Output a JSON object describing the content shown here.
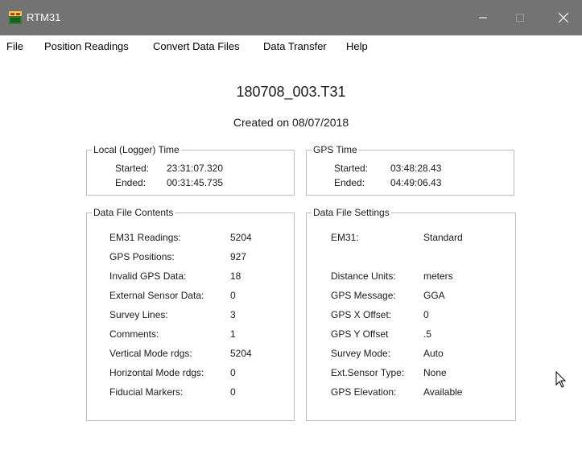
{
  "window": {
    "title": "RTM31",
    "minimize": "—",
    "maximize": "☐",
    "close": "✕",
    "app_icon": "rtm31-app-icon"
  },
  "menu": {
    "file": "File",
    "position": "Position Readings",
    "convert": "Convert Data Files",
    "transfer": "Data Transfer",
    "help": "Help"
  },
  "header": {
    "filename": "180708_003.T31",
    "created": "Created on 08/07/2018"
  },
  "local_time": {
    "title": "Local (Logger) Time",
    "started_label": "Started:",
    "started": "23:31:07.320",
    "ended_label": "Ended:",
    "ended": "00:31:45.735"
  },
  "gps_time": {
    "title": "GPS Time",
    "started_label": "Started:",
    "started": "03:48:28.43",
    "ended_label": "Ended:",
    "ended": "04:49:06.43"
  },
  "contents": {
    "title": "Data File Contents",
    "rows": [
      {
        "label": "EM31 Readings:",
        "value": "5204"
      },
      {
        "label": "GPS Positions:",
        "value": "927"
      },
      {
        "label": "Invalid GPS Data:",
        "value": "18"
      },
      {
        "label": "External Sensor Data:",
        "value": "0"
      },
      {
        "label": "Survey Lines:",
        "value": "3"
      },
      {
        "label": "Comments:",
        "value": "1"
      },
      {
        "label": "Vertical Mode rdgs:",
        "value": "5204"
      },
      {
        "label": "Horizontal Mode rdgs:",
        "value": "0"
      },
      {
        "label": "Fiducial Markers:",
        "value": "0"
      }
    ]
  },
  "settings": {
    "title": "Data File Settings",
    "em31_label": "EM31:",
    "em31": "Standard",
    "rows": [
      {
        "label": "Distance Units:",
        "value": "meters"
      },
      {
        "label": "GPS Message:",
        "value": "GGA"
      },
      {
        "label": "GPS X Offset:",
        "value": "0"
      },
      {
        "label": "GPS Y Offset",
        "value": ".5"
      },
      {
        "label": "Survey Mode:",
        "value": "Auto"
      },
      {
        "label": "Ext.Sensor Type:",
        "value": "None"
      },
      {
        "label": "GPS Elevation:",
        "value": "Available"
      }
    ]
  },
  "colors": {
    "titlebar": "#737373",
    "background": "#ffffff",
    "border": "#bdbdbd"
  }
}
